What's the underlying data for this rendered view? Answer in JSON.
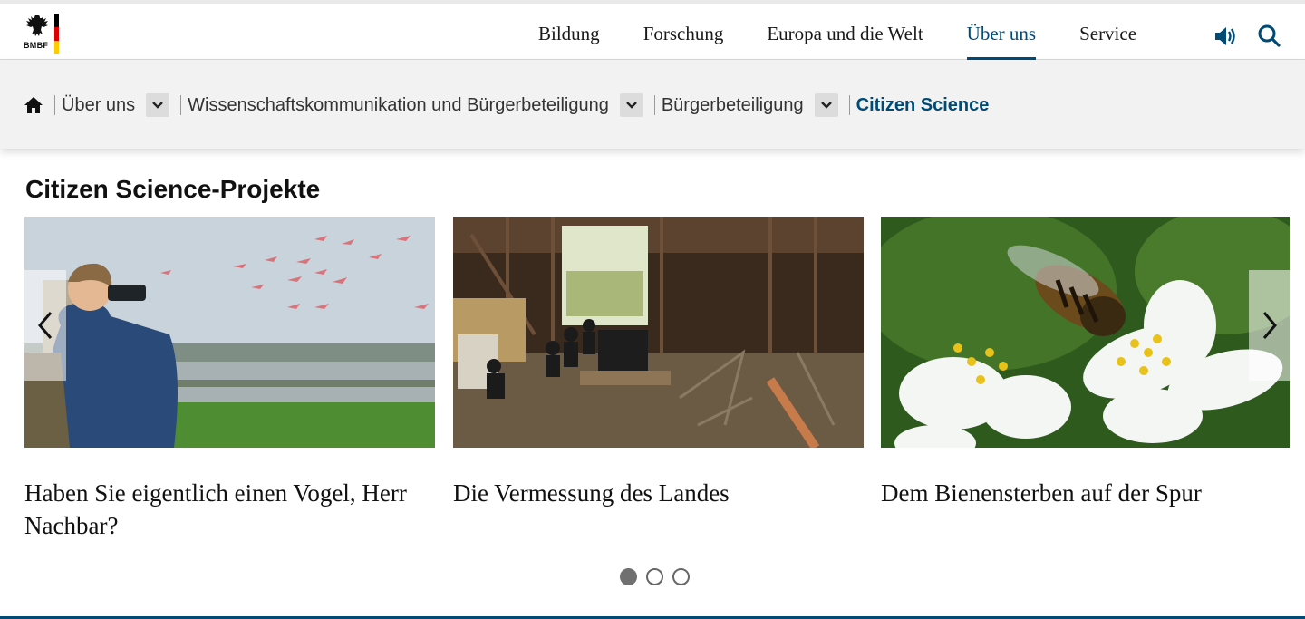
{
  "header": {
    "logo": {
      "brand": "BMBF",
      "flag_colors": [
        "#000000",
        "#dd0000",
        "#ffcc00"
      ]
    },
    "nav": [
      {
        "label": "Bildung",
        "active": false
      },
      {
        "label": "Forschung",
        "active": false
      },
      {
        "label": "Europa und die Welt",
        "active": false
      },
      {
        "label": "Über uns",
        "active": true
      },
      {
        "label": "Service",
        "active": false
      }
    ],
    "icons": {
      "audio": "speaker-icon",
      "search": "search-icon"
    }
  },
  "breadcrumb": {
    "home_icon": "home-icon",
    "items": [
      {
        "label": "Über uns",
        "has_dropdown": true
      },
      {
        "label": "Wissenschaftskommunikation und Bürgerbeteiligung",
        "has_dropdown": true
      },
      {
        "label": "Bürgerbeteiligung",
        "has_dropdown": true
      }
    ],
    "current": "Citizen Science"
  },
  "section": {
    "title": "Citizen Science-Projekte",
    "cards": [
      {
        "title": "Haben Sie eigentlich einen Vogel, Herr Nachbar?",
        "image": "boy-with-binoculars-flamingos"
      },
      {
        "title": "Die Vermessung des Landes",
        "image": "people-in-old-barn"
      },
      {
        "title": "Dem Bienensterben auf der Spur",
        "image": "bee-on-white-flower"
      }
    ],
    "carousel": {
      "prev_icon": "chevron-left-icon",
      "next_icon": "chevron-right-icon",
      "pages": 3,
      "active_page": 1
    }
  },
  "colors": {
    "accent": "#004b76",
    "breadcrumb_bg": "#f2f2f2"
  }
}
